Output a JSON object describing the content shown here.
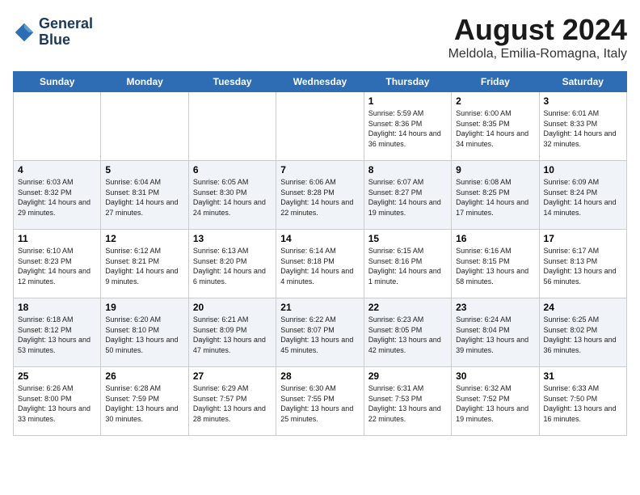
{
  "logo": {
    "line1": "General",
    "line2": "Blue"
  },
  "title": "August 2024",
  "subtitle": "Meldola, Emilia-Romagna, Italy",
  "days_of_week": [
    "Sunday",
    "Monday",
    "Tuesday",
    "Wednesday",
    "Thursday",
    "Friday",
    "Saturday"
  ],
  "weeks": [
    [
      {
        "day": "",
        "info": ""
      },
      {
        "day": "",
        "info": ""
      },
      {
        "day": "",
        "info": ""
      },
      {
        "day": "",
        "info": ""
      },
      {
        "day": "1",
        "info": "Sunrise: 5:59 AM\nSunset: 8:36 PM\nDaylight: 14 hours\nand 36 minutes."
      },
      {
        "day": "2",
        "info": "Sunrise: 6:00 AM\nSunset: 8:35 PM\nDaylight: 14 hours\nand 34 minutes."
      },
      {
        "day": "3",
        "info": "Sunrise: 6:01 AM\nSunset: 8:33 PM\nDaylight: 14 hours\nand 32 minutes."
      }
    ],
    [
      {
        "day": "4",
        "info": "Sunrise: 6:03 AM\nSunset: 8:32 PM\nDaylight: 14 hours\nand 29 minutes."
      },
      {
        "day": "5",
        "info": "Sunrise: 6:04 AM\nSunset: 8:31 PM\nDaylight: 14 hours\nand 27 minutes."
      },
      {
        "day": "6",
        "info": "Sunrise: 6:05 AM\nSunset: 8:30 PM\nDaylight: 14 hours\nand 24 minutes."
      },
      {
        "day": "7",
        "info": "Sunrise: 6:06 AM\nSunset: 8:28 PM\nDaylight: 14 hours\nand 22 minutes."
      },
      {
        "day": "8",
        "info": "Sunrise: 6:07 AM\nSunset: 8:27 PM\nDaylight: 14 hours\nand 19 minutes."
      },
      {
        "day": "9",
        "info": "Sunrise: 6:08 AM\nSunset: 8:25 PM\nDaylight: 14 hours\nand 17 minutes."
      },
      {
        "day": "10",
        "info": "Sunrise: 6:09 AM\nSunset: 8:24 PM\nDaylight: 14 hours\nand 14 minutes."
      }
    ],
    [
      {
        "day": "11",
        "info": "Sunrise: 6:10 AM\nSunset: 8:23 PM\nDaylight: 14 hours\nand 12 minutes."
      },
      {
        "day": "12",
        "info": "Sunrise: 6:12 AM\nSunset: 8:21 PM\nDaylight: 14 hours\nand 9 minutes."
      },
      {
        "day": "13",
        "info": "Sunrise: 6:13 AM\nSunset: 8:20 PM\nDaylight: 14 hours\nand 6 minutes."
      },
      {
        "day": "14",
        "info": "Sunrise: 6:14 AM\nSunset: 8:18 PM\nDaylight: 14 hours\nand 4 minutes."
      },
      {
        "day": "15",
        "info": "Sunrise: 6:15 AM\nSunset: 8:16 PM\nDaylight: 14 hours\nand 1 minute."
      },
      {
        "day": "16",
        "info": "Sunrise: 6:16 AM\nSunset: 8:15 PM\nDaylight: 13 hours\nand 58 minutes."
      },
      {
        "day": "17",
        "info": "Sunrise: 6:17 AM\nSunset: 8:13 PM\nDaylight: 13 hours\nand 56 minutes."
      }
    ],
    [
      {
        "day": "18",
        "info": "Sunrise: 6:18 AM\nSunset: 8:12 PM\nDaylight: 13 hours\nand 53 minutes."
      },
      {
        "day": "19",
        "info": "Sunrise: 6:20 AM\nSunset: 8:10 PM\nDaylight: 13 hours\nand 50 minutes."
      },
      {
        "day": "20",
        "info": "Sunrise: 6:21 AM\nSunset: 8:09 PM\nDaylight: 13 hours\nand 47 minutes."
      },
      {
        "day": "21",
        "info": "Sunrise: 6:22 AM\nSunset: 8:07 PM\nDaylight: 13 hours\nand 45 minutes."
      },
      {
        "day": "22",
        "info": "Sunrise: 6:23 AM\nSunset: 8:05 PM\nDaylight: 13 hours\nand 42 minutes."
      },
      {
        "day": "23",
        "info": "Sunrise: 6:24 AM\nSunset: 8:04 PM\nDaylight: 13 hours\nand 39 minutes."
      },
      {
        "day": "24",
        "info": "Sunrise: 6:25 AM\nSunset: 8:02 PM\nDaylight: 13 hours\nand 36 minutes."
      }
    ],
    [
      {
        "day": "25",
        "info": "Sunrise: 6:26 AM\nSunset: 8:00 PM\nDaylight: 13 hours\nand 33 minutes."
      },
      {
        "day": "26",
        "info": "Sunrise: 6:28 AM\nSunset: 7:59 PM\nDaylight: 13 hours\nand 30 minutes."
      },
      {
        "day": "27",
        "info": "Sunrise: 6:29 AM\nSunset: 7:57 PM\nDaylight: 13 hours\nand 28 minutes."
      },
      {
        "day": "28",
        "info": "Sunrise: 6:30 AM\nSunset: 7:55 PM\nDaylight: 13 hours\nand 25 minutes."
      },
      {
        "day": "29",
        "info": "Sunrise: 6:31 AM\nSunset: 7:53 PM\nDaylight: 13 hours\nand 22 minutes."
      },
      {
        "day": "30",
        "info": "Sunrise: 6:32 AM\nSunset: 7:52 PM\nDaylight: 13 hours\nand 19 minutes."
      },
      {
        "day": "31",
        "info": "Sunrise: 6:33 AM\nSunset: 7:50 PM\nDaylight: 13 hours\nand 16 minutes."
      }
    ]
  ]
}
